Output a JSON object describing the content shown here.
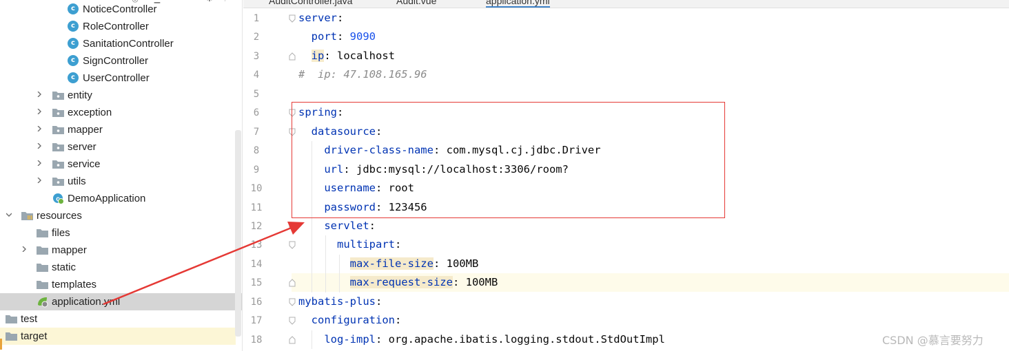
{
  "tree": {
    "items": [
      {
        "label": "NoticeController",
        "kind": "class",
        "icon": "class-icon",
        "expanded": null,
        "selected": false
      },
      {
        "label": "RoleController",
        "kind": "class",
        "icon": "class-icon",
        "expanded": null,
        "selected": false
      },
      {
        "label": "SanitationController",
        "kind": "class",
        "icon": "class-icon",
        "expanded": null,
        "selected": false
      },
      {
        "label": "SignController",
        "kind": "class",
        "icon": "class-icon",
        "expanded": null,
        "selected": false
      },
      {
        "label": "UserController",
        "kind": "class",
        "icon": "class-icon",
        "expanded": null,
        "selected": false
      },
      {
        "label": "entity",
        "kind": "package",
        "icon": "package-folder-icon",
        "expanded": false,
        "selected": false
      },
      {
        "label": "exception",
        "kind": "package",
        "icon": "package-folder-icon",
        "expanded": false,
        "selected": false
      },
      {
        "label": "mapper",
        "kind": "package",
        "icon": "package-folder-icon",
        "expanded": false,
        "selected": false
      },
      {
        "label": "server",
        "kind": "package",
        "icon": "package-folder-icon",
        "expanded": false,
        "selected": false
      },
      {
        "label": "service",
        "kind": "package",
        "icon": "package-folder-icon",
        "expanded": false,
        "selected": false
      },
      {
        "label": "utils",
        "kind": "package",
        "icon": "package-folder-icon",
        "expanded": false,
        "selected": false
      },
      {
        "label": "DemoApplication",
        "kind": "spring-class",
        "icon": "spring-boot-class-icon",
        "expanded": null,
        "selected": false
      },
      {
        "label": "resources",
        "kind": "resources",
        "icon": "resources-folder-icon",
        "expanded": true,
        "selected": false
      },
      {
        "label": "files",
        "kind": "folder",
        "icon": "folder-icon",
        "expanded": null,
        "selected": false
      },
      {
        "label": "mapper",
        "kind": "folder",
        "icon": "folder-icon",
        "expanded": false,
        "selected": false
      },
      {
        "label": "static",
        "kind": "folder",
        "icon": "folder-icon",
        "expanded": null,
        "selected": false
      },
      {
        "label": "templates",
        "kind": "folder",
        "icon": "folder-icon",
        "expanded": null,
        "selected": false
      },
      {
        "label": "application.yml",
        "kind": "yml",
        "icon": "yaml-spring-file-icon",
        "expanded": null,
        "selected": true
      },
      {
        "label": "test",
        "kind": "folder",
        "icon": "folder-icon",
        "expanded": null,
        "selected": false
      },
      {
        "label": "target",
        "kind": "excluded-folder",
        "icon": "excluded-folder-icon",
        "expanded": null,
        "selected": false
      }
    ]
  },
  "tabs": [
    {
      "label": "AuditController.java",
      "active": false
    },
    {
      "label": "Audit.vue",
      "active": false
    },
    {
      "label": "application.yml",
      "active": true
    }
  ],
  "editor": {
    "current_line": 15,
    "lines": [
      {
        "n": "1",
        "tokens": [
          {
            "t": "server",
            "c": "k"
          },
          {
            "t": ":",
            "c": "p"
          }
        ]
      },
      {
        "n": "2",
        "tokens": [
          {
            "t": "  ",
            "c": "p"
          },
          {
            "t": "port",
            "c": "k"
          },
          {
            "t": ": ",
            "c": "p"
          },
          {
            "t": "9090",
            "c": "n"
          }
        ]
      },
      {
        "n": "3",
        "tokens": [
          {
            "t": "  ",
            "c": "p"
          },
          {
            "t": "ip",
            "c": "kh"
          },
          {
            "t": ": localhost",
            "c": "v"
          }
        ]
      },
      {
        "n": "4",
        "tokens": [
          {
            "t": "#  ip: 47.108.165.96",
            "c": "c"
          }
        ]
      },
      {
        "n": "5",
        "tokens": []
      },
      {
        "n": "6",
        "tokens": [
          {
            "t": "spring",
            "c": "k"
          },
          {
            "t": ":",
            "c": "p"
          }
        ]
      },
      {
        "n": "7",
        "tokens": [
          {
            "t": "  ",
            "c": "p"
          },
          {
            "t": "datasource",
            "c": "k"
          },
          {
            "t": ":",
            "c": "p"
          }
        ]
      },
      {
        "n": "8",
        "tokens": [
          {
            "t": "    ",
            "c": "p"
          },
          {
            "t": "driver-class-name",
            "c": "k"
          },
          {
            "t": ": com.mysql.cj.jdbc.Driver",
            "c": "v"
          }
        ]
      },
      {
        "n": "9",
        "tokens": [
          {
            "t": "    ",
            "c": "p"
          },
          {
            "t": "url",
            "c": "k"
          },
          {
            "t": ": jdbc:mysql://localhost:3306/room?",
            "c": "v"
          }
        ]
      },
      {
        "n": "10",
        "tokens": [
          {
            "t": "    ",
            "c": "p"
          },
          {
            "t": "username",
            "c": "k"
          },
          {
            "t": ": root",
            "c": "v"
          }
        ]
      },
      {
        "n": "11",
        "tokens": [
          {
            "t": "    ",
            "c": "p"
          },
          {
            "t": "password",
            "c": "k"
          },
          {
            "t": ": 123456",
            "c": "v"
          }
        ]
      },
      {
        "n": "12",
        "tokens": [
          {
            "t": "    ",
            "c": "p"
          },
          {
            "t": "servlet",
            "c": "k"
          },
          {
            "t": ":",
            "c": "p"
          }
        ]
      },
      {
        "n": "13",
        "tokens": [
          {
            "t": "      ",
            "c": "p"
          },
          {
            "t": "multipart",
            "c": "k"
          },
          {
            "t": ":",
            "c": "p"
          }
        ]
      },
      {
        "n": "14",
        "tokens": [
          {
            "t": "        ",
            "c": "p"
          },
          {
            "t": "max-file-size",
            "c": "kh"
          },
          {
            "t": ": 100MB",
            "c": "v"
          }
        ]
      },
      {
        "n": "15",
        "tokens": [
          {
            "t": "        ",
            "c": "p"
          },
          {
            "t": "max-request-size",
            "c": "kh"
          },
          {
            "t": ": 100MB",
            "c": "v"
          }
        ]
      },
      {
        "n": "16",
        "tokens": [
          {
            "t": "mybatis-plus",
            "c": "k"
          },
          {
            "t": ":",
            "c": "p"
          }
        ]
      },
      {
        "n": "17",
        "tokens": [
          {
            "t": "  ",
            "c": "p"
          },
          {
            "t": "configuration",
            "c": "k"
          },
          {
            "t": ":",
            "c": "p"
          }
        ]
      },
      {
        "n": "18",
        "tokens": [
          {
            "t": "    ",
            "c": "p"
          },
          {
            "t": "log-impl",
            "c": "k"
          },
          {
            "t": ": org.apache.ibatis.logging.stdout.StdOutImpl",
            "c": "v"
          }
        ]
      }
    ]
  },
  "annotation": {
    "box_color": "#e53935",
    "arrow_color": "#e53935"
  },
  "watermark": "CSDN @慕言要努力",
  "colors": {
    "key": "#0033b3",
    "number": "#1750eb",
    "comment": "#8c8c8c",
    "selection": "#d5d5d5",
    "caret_line": "#fefbea",
    "class_icon": "#3d9fd1"
  }
}
